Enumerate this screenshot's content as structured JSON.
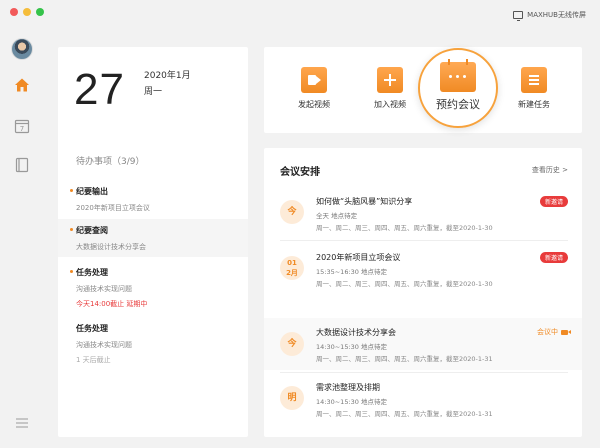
{
  "app": {
    "cast_label": "MAXHUB无线传屏"
  },
  "colors": {
    "accent": "#f08a24",
    "danger": "#e83b3b",
    "background": "#f2f2f2"
  },
  "sidebar": {
    "icons": [
      "avatar",
      "home-icon",
      "calendar-icon",
      "document-icon",
      "menu-icon"
    ],
    "calendar_day": "7"
  },
  "date": {
    "day": "27",
    "year_month": "2020年1月",
    "weekday": "周一"
  },
  "todo": {
    "title": "待办事项（3/9）",
    "items": [
      {
        "title": "纪要输出",
        "sub": "2020年新项目立项会议",
        "note": ""
      },
      {
        "title": "纪要查阅",
        "sub": "大数据设计技术分享会",
        "note": ""
      },
      {
        "title": "任务处理",
        "sub": "沟通技术实现问题",
        "note": "今天14:00截止  延期中"
      },
      {
        "title": "任务处理",
        "sub": "沟通技术实现问题",
        "note": "1 天后截止"
      }
    ]
  },
  "actions": {
    "start_video": "发起视频",
    "join_video": "加入视频",
    "book_meeting": "预约会议",
    "new_task": "新建任务"
  },
  "meetings": {
    "title": "会议安排",
    "history": "查看历史 >",
    "items": [
      {
        "badge": "今",
        "badge_sub": "",
        "title": "如何做“头脑风暴”知识分享",
        "time": "全天     地点待定",
        "repeat": "周一、周二、周三、周四、周五、周六重复，截至2020-1-30",
        "tag": "新邀请"
      },
      {
        "badge": "01",
        "badge_sub": "2月",
        "title": "2020年新项目立项会议",
        "time": "15:35~16:30     地点待定",
        "repeat": "周一、周二、周三、周四、周五、周六重复，截至2020-1-30",
        "tag": "新邀请"
      },
      {
        "badge": "今",
        "badge_sub": "",
        "title": "大数据设计技术分享会",
        "time": "14:30~15:30     地点待定",
        "repeat": "周一、周二、周三、周四、周五、周六重复，截至2020-1-31",
        "tag": "会议中"
      },
      {
        "badge": "明",
        "badge_sub": "",
        "title": "需求池整理及排期",
        "time": "14:30~15:30     地点待定",
        "repeat": "周一、周二、周三、周四、周五、周六重复，截至2020-1-31",
        "tag": ""
      }
    ]
  }
}
